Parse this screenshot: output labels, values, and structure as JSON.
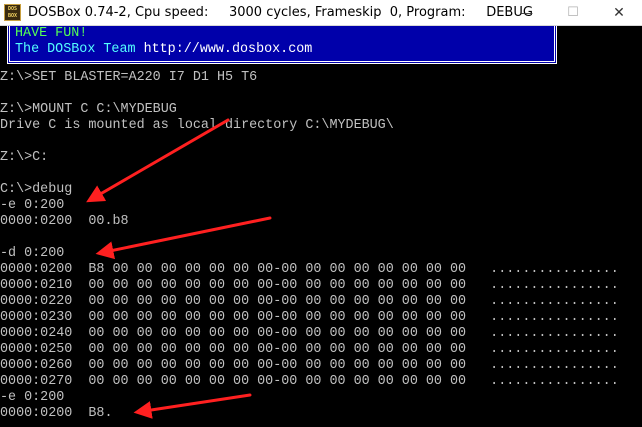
{
  "window": {
    "icon_label": "DOS BOX",
    "title": "DOSBox 0.74-2, Cpu speed:     3000 cycles, Frameskip  0, Program:     DEBUG",
    "minimize_glyph": "—",
    "maximize_glyph": "☐",
    "close_glyph": "✕"
  },
  "banner": {
    "line1": "HAVE FUN!",
    "line2_prefix": "The DOSBox Team ",
    "line2_url": "http://www.dosbox.com"
  },
  "terminal": {
    "lines": [
      "Z:\\>SET BLASTER=A220 I7 D1 H5 T6",
      "",
      "Z:\\>MOUNT C C:\\MYDEBUG",
      "Drive C is mounted as local directory C:\\MYDEBUG\\",
      "",
      "Z:\\>C:",
      "",
      "C:\\>debug",
      "-e 0:200",
      "0000:0200  00.b8",
      "",
      "-d 0:200",
      "0000:0200  B8 00 00 00 00 00 00 00-00 00 00 00 00 00 00 00   ................",
      "0000:0210  00 00 00 00 00 00 00 00-00 00 00 00 00 00 00 00   ................",
      "0000:0220  00 00 00 00 00 00 00 00-00 00 00 00 00 00 00 00   ................",
      "0000:0230  00 00 00 00 00 00 00 00-00 00 00 00 00 00 00 00   ................",
      "0000:0240  00 00 00 00 00 00 00 00-00 00 00 00 00 00 00 00   ................",
      "0000:0250  00 00 00 00 00 00 00 00-00 00 00 00 00 00 00 00   ................",
      "0000:0260  00 00 00 00 00 00 00 00-00 00 00 00 00 00 00 00   ................",
      "0000:0270  00 00 00 00 00 00 00 00-00 00 00 00 00 00 00 00   ................",
      "-e 0:200",
      "0000:0200  B8."
    ]
  },
  "colors": {
    "console_bg": "#000000",
    "console_text": "#c0c0c0",
    "banner_bg": "#0000aa",
    "banner_green": "#55ff55",
    "banner_cyan": "#55ffff",
    "annotation_arrow": "#ff2020"
  }
}
